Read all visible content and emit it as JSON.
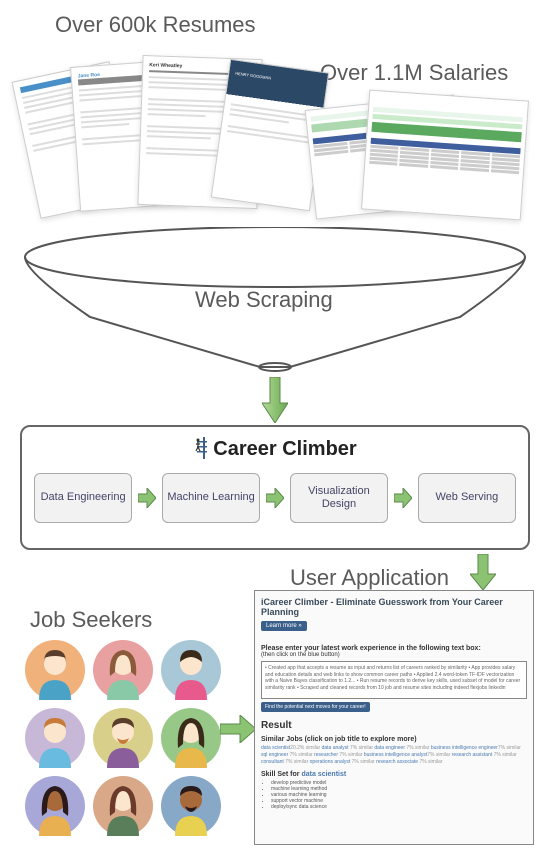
{
  "labels": {
    "resumes": "Over 600k Resumes",
    "salaries": "Over 1.1M Salaries",
    "scraping": "Web Scraping",
    "userapp": "User Application",
    "seekers": "Job Seekers"
  },
  "resumes": {
    "r2_name": "Jane Roe",
    "r3_name": "Keri Wheatley",
    "r4_name": "HENRY GOODMAN"
  },
  "career_climber": {
    "title": "Career Climber",
    "steps": [
      "Data Engineering",
      "Machine Learning",
      "Visualization Design",
      "Web Serving"
    ]
  },
  "app": {
    "title": "iCareer Climber - Eliminate Guesswork from Your Career Planning",
    "learn_more": "Learn more »",
    "prompt": "Please enter your latest work experience in the following text box:",
    "hint": "(then click on the blue button)",
    "textarea_sample": "• Created app that accepts a resume as input and returns list of careers ranked by similarity\n• App provides salary and education details and web links to show common career paths\n• Applied 2.4 word-token TF-IDF vectorization with a Naive Bayes classification to 1.2...\n• Run resume records to derive key skills, used subset of model for career similarity rank\n• Scraped and cleaned records from 10 job and resume sites including indeed flexjobs linkedin",
    "submit": "Find the potential next moves for your career!",
    "result": "Result",
    "similar_h": "Similar Jobs (click on job title to explore more)",
    "tags": "data scientist",
    "tags_rest_1": "data analyst",
    "tags_rest_2": "data engineer",
    "tags_rest_3": "business intelligence engineer",
    "tags_rest_4": "sql engineer",
    "tags_rest_5": "researcher",
    "tags_rest_6": "business intelligence analyst",
    "tags_rest_7": "research assistant",
    "tags_rest_8": "consultant",
    "tags_rest_9": "operations analyst",
    "tags_rest_10": "research associate",
    "pct_main": "20.2% similar",
    "pct_small": "7% similar",
    "skills_h_prefix": "Skill Set for ",
    "skills_h_job": "data scientist",
    "skills": [
      "develop predictive model",
      "machine learning method",
      "various machine learning",
      "support vector machine",
      "deploy/sync data science"
    ]
  }
}
